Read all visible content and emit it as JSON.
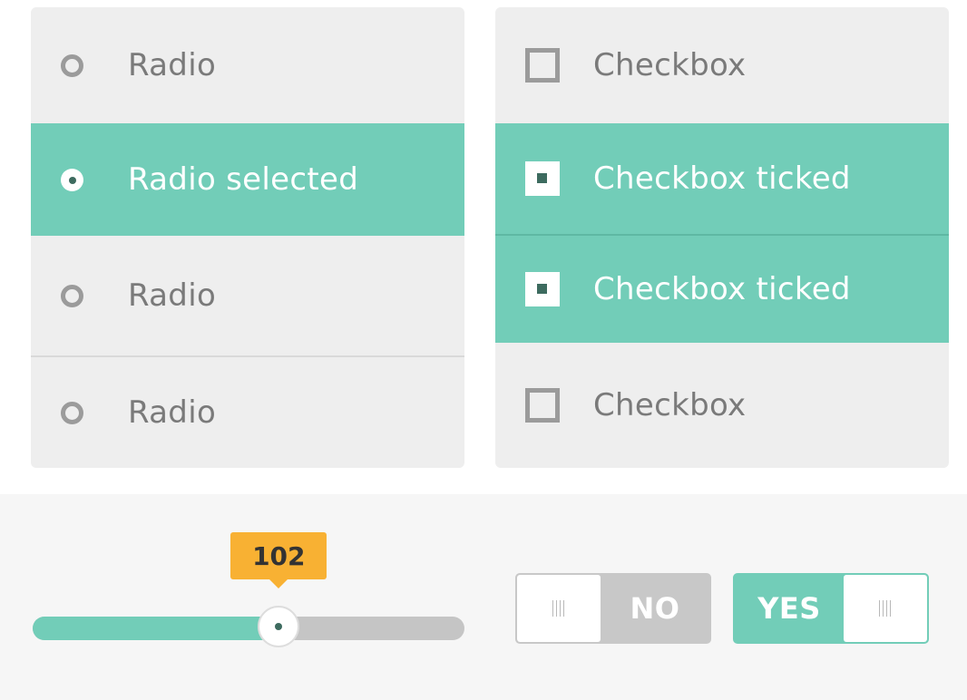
{
  "colors": {
    "accent": "#72cdb8",
    "panel_bg": "#eeeeee",
    "text_muted": "#7a7a7a",
    "bubble": "#f8b133",
    "toggle_off": "#c8c8c8"
  },
  "radio_group": {
    "options": [
      {
        "label": "Radio",
        "selected": false,
        "icon": "radio-unchecked-icon"
      },
      {
        "label": "Radio selected",
        "selected": true,
        "icon": "radio-checked-icon"
      },
      {
        "label": "Radio",
        "selected": false,
        "icon": "radio-unchecked-icon"
      },
      {
        "label": "Radio",
        "selected": false,
        "icon": "radio-unchecked-icon"
      }
    ]
  },
  "checkbox_group": {
    "options": [
      {
        "label": "Checkbox",
        "checked": false,
        "icon": "checkbox-unchecked-icon"
      },
      {
        "label": "Checkbox ticked",
        "checked": true,
        "icon": "checkbox-checked-icon"
      },
      {
        "label": "Checkbox ticked",
        "checked": true,
        "icon": "checkbox-checked-icon"
      },
      {
        "label": "Checkbox",
        "checked": false,
        "icon": "checkbox-unchecked-icon"
      }
    ]
  },
  "slider": {
    "value": "102",
    "fill_fraction": 0.57
  },
  "toggles": {
    "off": {
      "label": "NO",
      "state": false,
      "icon": "grip-icon"
    },
    "on": {
      "label": "YES",
      "state": true,
      "icon": "grip-icon"
    }
  }
}
